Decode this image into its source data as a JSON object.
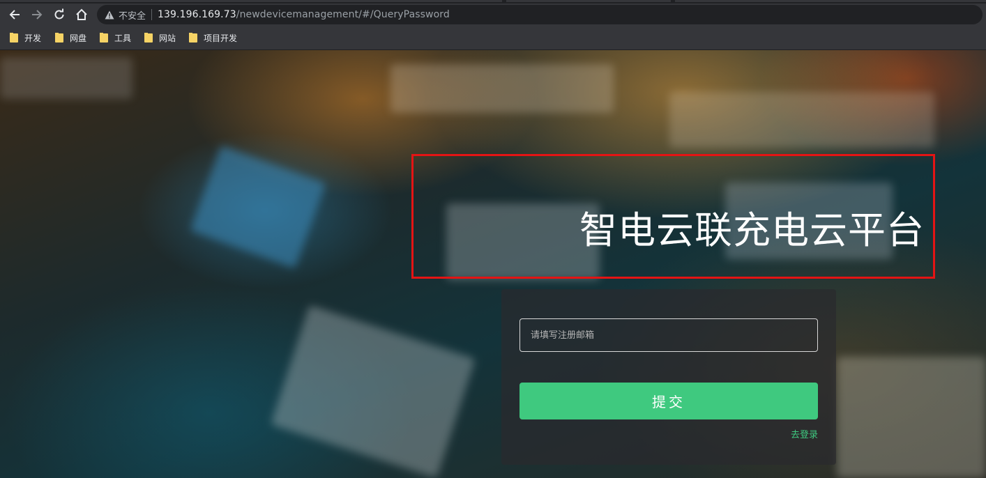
{
  "browser": {
    "security_label": "不安全",
    "url_host": "139.196.169.73",
    "url_path": "/newdevicemanagement/#/QueryPassword",
    "bookmarks": [
      {
        "label": "开发"
      },
      {
        "label": "网盘"
      },
      {
        "label": "工具"
      },
      {
        "label": "网站"
      },
      {
        "label": "项目开发"
      }
    ]
  },
  "page": {
    "title": "智电云联充电云平台",
    "email_placeholder": "请填写注册邮箱",
    "submit_label": "提交",
    "login_link": "去登录"
  },
  "colors": {
    "accent": "#3fc97f",
    "highlight_box": "#e41414"
  }
}
